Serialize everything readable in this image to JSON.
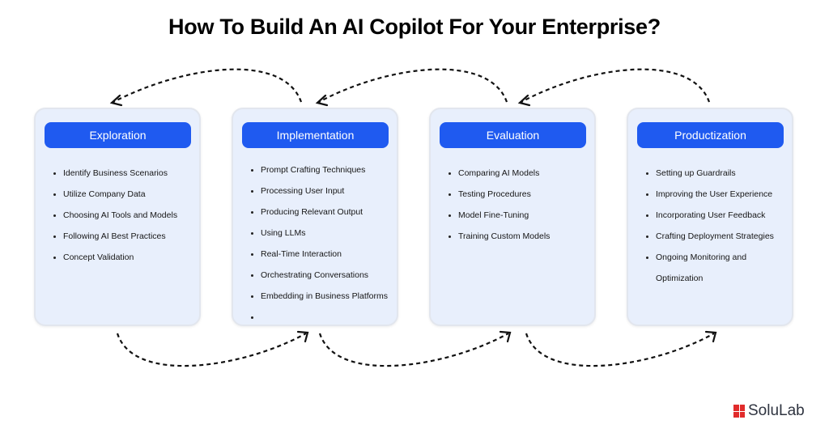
{
  "title": "How To Build An AI Copilot For Your Enterprise?",
  "stages": [
    {
      "name": "Exploration",
      "items": [
        "Identify Business Scenarios",
        "Utilize Company Data",
        "Choosing AI Tools and Models",
        "Following AI Best Practices",
        "Concept Validation"
      ]
    },
    {
      "name": "Implementation",
      "items": [
        "Prompt Crafting Techniques",
        "Processing User Input",
        "Producing Relevant Output",
        "Using LLMs",
        "Real-Time Interaction",
        "Orchestrating Conversations",
        "Embedding in Business Platforms",
        ""
      ]
    },
    {
      "name": "Evaluation",
      "items": [
        "Comparing AI Models",
        "Testing Procedures",
        "Model Fine-Tuning",
        "Training Custom Models"
      ]
    },
    {
      "name": "Productization",
      "items": [
        "Setting up Guardrails",
        "Improving the User Experience",
        "Incorporating User Feedback",
        "Crafting Deployment Strategies",
        "Ongoing Monitoring and",
        "Optimization"
      ]
    }
  ],
  "logo": {
    "text": "SoluLab",
    "color": "#e12b2b"
  },
  "colors": {
    "header": "#1f5af0",
    "card": "#e8effc"
  }
}
